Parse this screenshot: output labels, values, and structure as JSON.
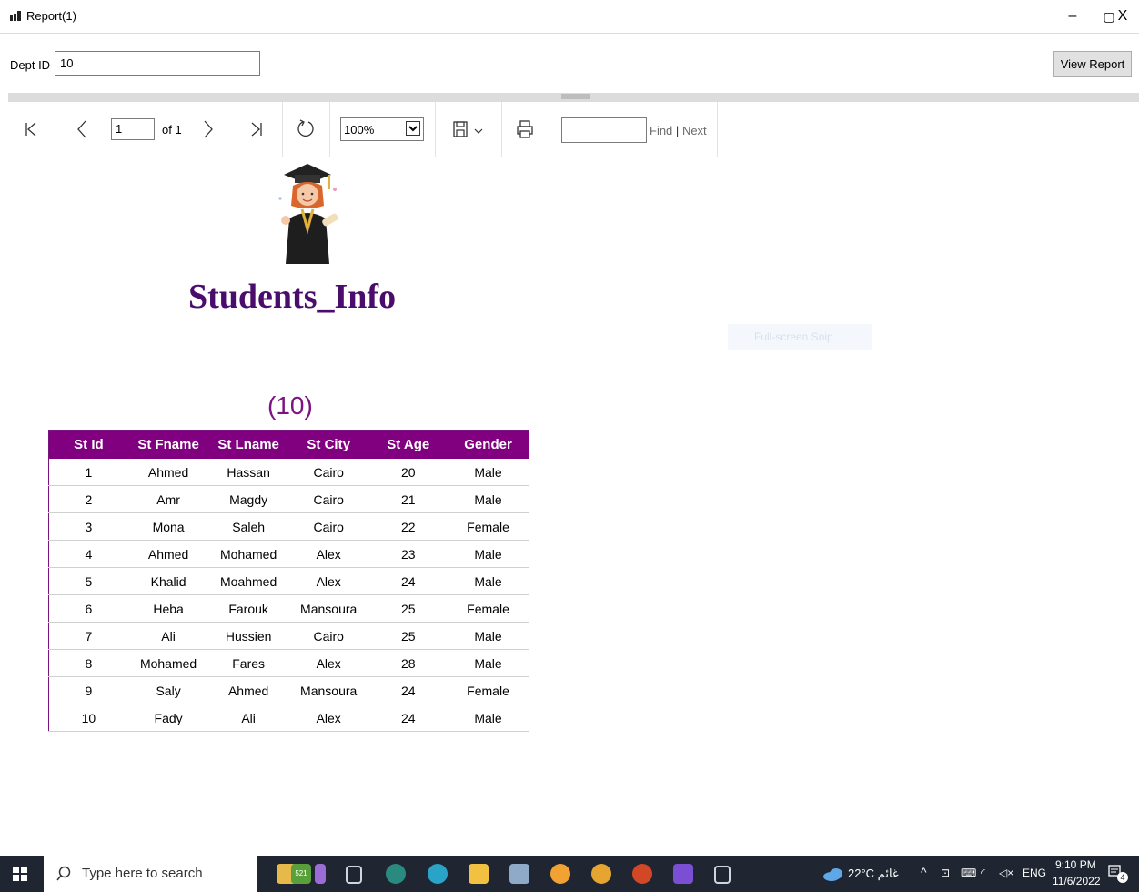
{
  "window": {
    "title": "Report(1)",
    "controls": {
      "minimize": "–",
      "maximize": "▢",
      "close": "X"
    }
  },
  "params": {
    "dept_label": "Dept ID",
    "dept_value": "10",
    "view_report": "View Report"
  },
  "toolbar": {
    "page": "1",
    "of_label": "of 1",
    "zoom": "100%",
    "find_label": "Find",
    "separator": "|",
    "next_label": "Next"
  },
  "report": {
    "title": "Students_Info",
    "dept_display": "(10)",
    "columns": [
      "St Id",
      "St Fname",
      "St Lname",
      "St City",
      "St Age",
      "Gender"
    ],
    "rows": [
      [
        "1",
        "Ahmed",
        "Hassan",
        "Cairo",
        "20",
        "Male"
      ],
      [
        "2",
        "Amr",
        "Magdy",
        "Cairo",
        "21",
        "Male"
      ],
      [
        "3",
        "Mona",
        "Saleh",
        "Cairo",
        "22",
        "Female"
      ],
      [
        "4",
        "Ahmed",
        "Mohamed",
        "Alex",
        "23",
        "Male"
      ],
      [
        "5",
        "Khalid",
        "Moahmed",
        "Alex",
        "24",
        "Male"
      ],
      [
        "6",
        "Heba",
        "Farouk",
        "Mansoura",
        "25",
        "Female"
      ],
      [
        "7",
        "Ali",
        "Hussien",
        "Cairo",
        "25",
        "Male"
      ],
      [
        "8",
        "Mohamed",
        "Fares",
        "Alex",
        "28",
        "Male"
      ],
      [
        "9",
        "Saly",
        "Ahmed",
        "Mansoura",
        "24",
        "Female"
      ],
      [
        "10",
        "Fady",
        "Ali",
        "Alex",
        "24",
        "Male"
      ]
    ]
  },
  "overlay": {
    "snip_label": "Full-screen Snip"
  },
  "taskbar": {
    "search_placeholder": "Type here to search",
    "weather": "22°C غائم",
    "lang": "ENG",
    "time": "9:10 PM",
    "date": "11/6/2022",
    "notif_count": "4",
    "pinned_badge": "521",
    "apps": [
      "task-view",
      "edge-beta",
      "edge",
      "file-explorer",
      "paint",
      "chrome",
      "chrome-canary",
      "powerpoint",
      "visual-studio",
      "snip"
    ]
  },
  "colors": {
    "header_bg": "#800080",
    "title_color": "#4b0d6b",
    "dept_color": "#7b1380",
    "taskbar_bg": "#1f2632"
  }
}
